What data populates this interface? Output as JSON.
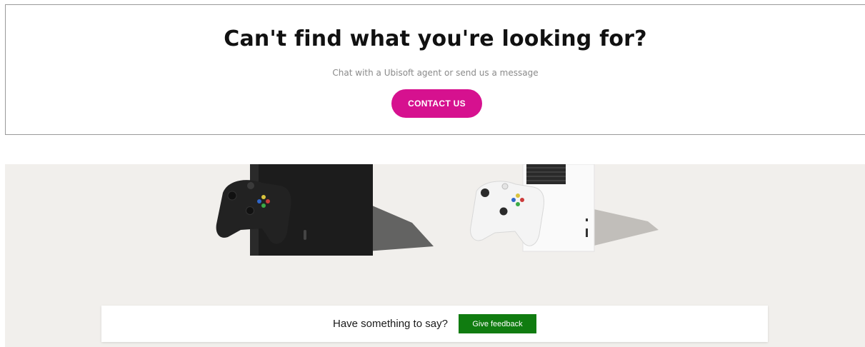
{
  "contact": {
    "title": "Can't find what you're looking for?",
    "subtitle": "Chat with a Ubisoft agent or send us a message",
    "button_label": "CONTACT US",
    "accent_color": "#d6118f"
  },
  "hero": {
    "background_color": "#f1efec",
    "products": [
      "Xbox Series X with black controller",
      "Xbox Series S with white controller"
    ]
  },
  "feedback": {
    "prompt": "Have something to say?",
    "button_label": "Give feedback",
    "button_color": "#107c10"
  }
}
